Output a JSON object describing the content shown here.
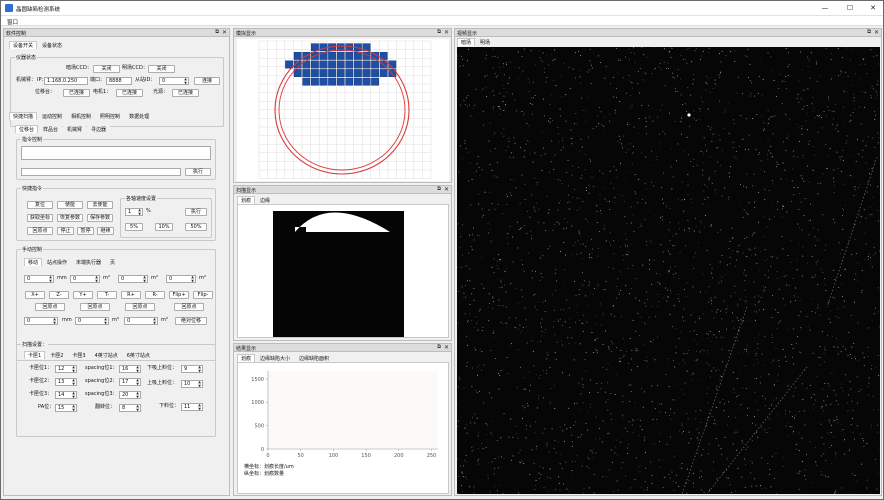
{
  "window": {
    "title": "晶圆缺陷检测系统",
    "minimize": "—",
    "maximize": "☐",
    "close": "✕"
  },
  "menu": {
    "window": "窗口"
  },
  "dock_common": {
    "float": "⧉",
    "close": "✕"
  },
  "control": {
    "title": "软件控制",
    "top_tabs": [
      "设备开关",
      "设备状态"
    ],
    "status": {
      "group": "仪器状态",
      "dark_ccd_label": "暗场CCD：",
      "dark_ccd_btn": "关闭",
      "bright_ccd_label": "明场CCD：",
      "bright_ccd_btn": "关闭",
      "arm_label": "机械臂：",
      "ip_label": "IP：",
      "ip_value": "1.168.0.250",
      "port_label": "端口：",
      "port_value": "8888",
      "slave_label": "从站ID：",
      "slave_value": "0",
      "connect_btn": "连接",
      "stage_label": "位移台：",
      "stage_btn": "已连接",
      "motor_label": "电机1：",
      "motor_btn": "已连接",
      "light_label": "光源：",
      "light_btn": "已连接"
    },
    "main_tabs": [
      "快捷扫描",
      "运动控制",
      "相机控制",
      "照明控制",
      "数据处理"
    ],
    "sub_tabs": [
      "位移台",
      "样品台",
      "机械臂",
      "寻边器"
    ],
    "command": {
      "group": "指令控制",
      "exec_btn": "执行"
    },
    "quick": {
      "group": "快捷指令",
      "buttons": [
        "复位",
        "使能",
        "去使能",
        "获取坐标",
        "恢复参数",
        "保存参数",
        "回原点",
        "停止",
        "暂停",
        "继续"
      ],
      "speed_group": "各轴速度设置",
      "speed_value": "1",
      "speed_unit": "%",
      "speed_exec": "执行",
      "presets": [
        "5%",
        "10%",
        "50%"
      ]
    },
    "manual": {
      "group": "手动控制",
      "tabs": [
        "移动",
        "站点操作",
        "末端执行器",
        "页"
      ],
      "row1": [
        {
          "value": "0",
          "unit": "mm"
        },
        {
          "value": "0",
          "unit": "m°"
        },
        {
          "value": "0",
          "unit": "m°"
        },
        {
          "value": "0",
          "unit": "m°"
        }
      ],
      "axis_buttons": [
        "X+",
        "Z-",
        "Y+",
        "T-",
        "R+",
        "R-",
        "Flip+",
        "Flip-"
      ],
      "home_buttons": [
        "回原点",
        "回原点",
        "回原点",
        "回原点"
      ],
      "row2": [
        {
          "value": "0",
          "unit": "mm"
        },
        {
          "value": "0",
          "unit": "m°"
        },
        {
          "value": "0",
          "unit": "m°"
        }
      ],
      "move_btn": "绝对位移"
    },
    "scan": {
      "group": "扫描设置：",
      "tabs": [
        "卡匣1",
        "卡匣2",
        "卡匣3",
        "4英寸站点",
        "6英寸站点"
      ],
      "fields": [
        {
          "label": "卡匣位1：",
          "value": "12"
        },
        {
          "label": "spacing位1：",
          "value": "16"
        },
        {
          "label": "下吸上料位：",
          "value": "9"
        },
        {
          "label": "卡匣位2：",
          "value": "13"
        },
        {
          "label": "spacing位2：",
          "value": "17"
        },
        {
          "label": "上吸上料位：",
          "value": "10"
        },
        {
          "label": "卡匣位3：",
          "value": "14"
        },
        {
          "label": "spacing位3：",
          "value": "20"
        },
        {
          "label": "PA位：",
          "value": "15"
        },
        {
          "label": "翻转位：",
          "value": "8"
        },
        {
          "label": "下料位：",
          "value": "11"
        }
      ]
    }
  },
  "sim": {
    "title": "模拟显示"
  },
  "scan_display": {
    "title": "扫描显示",
    "tabs": [
      "划痕",
      "边缘"
    ]
  },
  "results": {
    "title": "结果显示",
    "tabs": [
      "划痕",
      "边缘缺陷大小",
      "边缘缺陷面积"
    ],
    "xlabel": "横坐标：划痕长度/um",
    "ylabel": "纵坐标：划痕数量"
  },
  "video": {
    "title": "视频显示",
    "tabs": [
      "暗场",
      "明场"
    ]
  },
  "chart_data": {
    "type": "bar",
    "title": "",
    "xlabel": "横坐标：划痕长度/um",
    "ylabel": "纵坐标：划痕数量",
    "xlim": [
      0,
      260
    ],
    "ylim": [
      0,
      1500
    ],
    "xticks": [
      0,
      50,
      100,
      150,
      200,
      250
    ],
    "yticks": [
      0,
      500,
      1000,
      1500
    ],
    "values": []
  },
  "colors": {
    "accent": "#2a62c9",
    "wafer_ring": "#d83a3a",
    "die_fill": "#1f4fa5",
    "video_bg": "#060606"
  }
}
